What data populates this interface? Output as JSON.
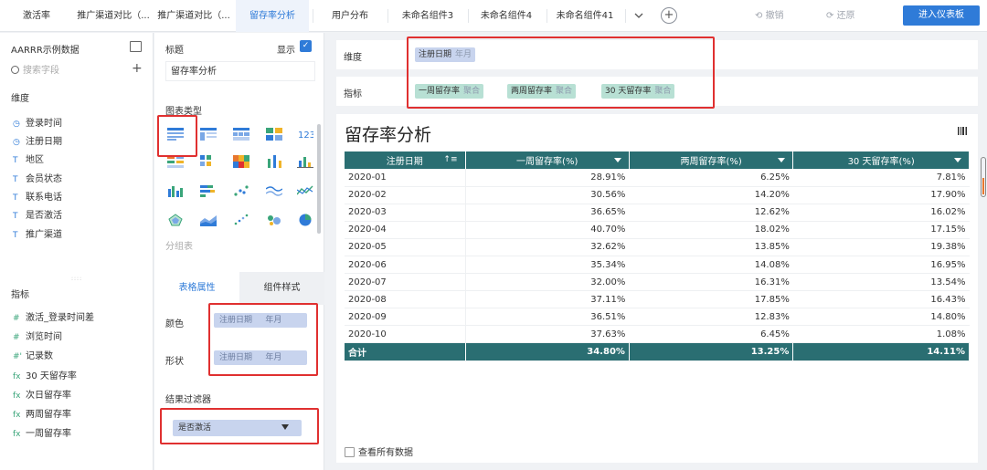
{
  "top_tabs": [
    "激活率",
    "推广渠道对比（...",
    "推广渠道对比（...",
    "留存率分析",
    "用户分布",
    "未命名组件3",
    "未命名组件4",
    "未命名组件41"
  ],
  "active_tab_index": 3,
  "toolbar": {
    "undo": "撤销",
    "redo": "还原",
    "enter_dashboard": "进入仪表板"
  },
  "left_panel": {
    "dataset": "AARRR示例数据",
    "search_placeholder": "搜索字段",
    "dimension_title": "维度",
    "dimensions": [
      {
        "icon": "clock-icon",
        "label": "登录时间"
      },
      {
        "icon": "clock-icon",
        "label": "注册日期"
      },
      {
        "icon": "text-icon",
        "label": "地区"
      },
      {
        "icon": "text-icon",
        "label": "会员状态"
      },
      {
        "icon": "text-icon",
        "label": "联系电话"
      },
      {
        "icon": "text-icon",
        "label": "是否激活"
      },
      {
        "icon": "text-icon",
        "label": "推广渠道"
      }
    ],
    "metric_title": "指标",
    "metrics": [
      {
        "icon": "#",
        "label": "激活_登录时间差"
      },
      {
        "icon": "#",
        "label": "浏览时间"
      },
      {
        "icon": "#'",
        "label": "记录数"
      },
      {
        "icon": "fx",
        "label": "30 天留存率"
      },
      {
        "icon": "fx",
        "label": "次日留存率"
      },
      {
        "icon": "fx",
        "label": "两周留存率"
      },
      {
        "icon": "fx",
        "label": "一周留存率"
      }
    ]
  },
  "config_panel": {
    "title_label": "标题",
    "show_label": "显示",
    "title_value": "留存率分析",
    "chart_type_label": "图表类型",
    "group_table_label": "分组表",
    "subtab_table_props": "表格属性",
    "subtab_component_style": "组件样式",
    "color_label": "颜色",
    "shape_label": "形状",
    "color_pill": {
      "field": "注册日期",
      "granularity": "年月"
    },
    "shape_pill": {
      "field": "注册日期",
      "granularity": "年月"
    },
    "result_filter_label": "结果过滤器",
    "filter_pill": "是否激活"
  },
  "dimension_bar": {
    "label": "维度",
    "pill": {
      "field": "注册日期",
      "granularity": "年月"
    }
  },
  "metric_bar": {
    "label": "指标",
    "pills": [
      {
        "field": "一周留存率",
        "agg": "聚合"
      },
      {
        "field": "两周留存率",
        "agg": "聚合"
      },
      {
        "field": "30 天留存率",
        "agg": "聚合"
      }
    ]
  },
  "chart": {
    "title": "留存率分析",
    "headers": [
      "注册日期",
      "一周留存率(%)",
      "两周留存率(%)",
      "30 天留存率(%)"
    ],
    "rows": [
      [
        "2020-01",
        "28.91%",
        "6.25%",
        "7.81%"
      ],
      [
        "2020-02",
        "30.56%",
        "14.20%",
        "17.90%"
      ],
      [
        "2020-03",
        "36.65%",
        "12.62%",
        "16.02%"
      ],
      [
        "2020-04",
        "40.70%",
        "18.02%",
        "17.15%"
      ],
      [
        "2020-05",
        "32.62%",
        "13.85%",
        "19.38%"
      ],
      [
        "2020-06",
        "35.34%",
        "14.08%",
        "16.95%"
      ],
      [
        "2020-07",
        "32.00%",
        "16.31%",
        "13.54%"
      ],
      [
        "2020-08",
        "37.11%",
        "17.85%",
        "16.43%"
      ],
      [
        "2020-09",
        "36.51%",
        "12.83%",
        "14.80%"
      ],
      [
        "2020-10",
        "37.63%",
        "6.45%",
        "1.08%"
      ]
    ],
    "total": [
      "合计",
      "34.80%",
      "13.25%",
      "14.11%"
    ],
    "view_all": "查看所有数据"
  },
  "colors": {
    "accent": "#2f7bd8",
    "table_header": "#2a6e72",
    "highlight": "#e03030"
  }
}
